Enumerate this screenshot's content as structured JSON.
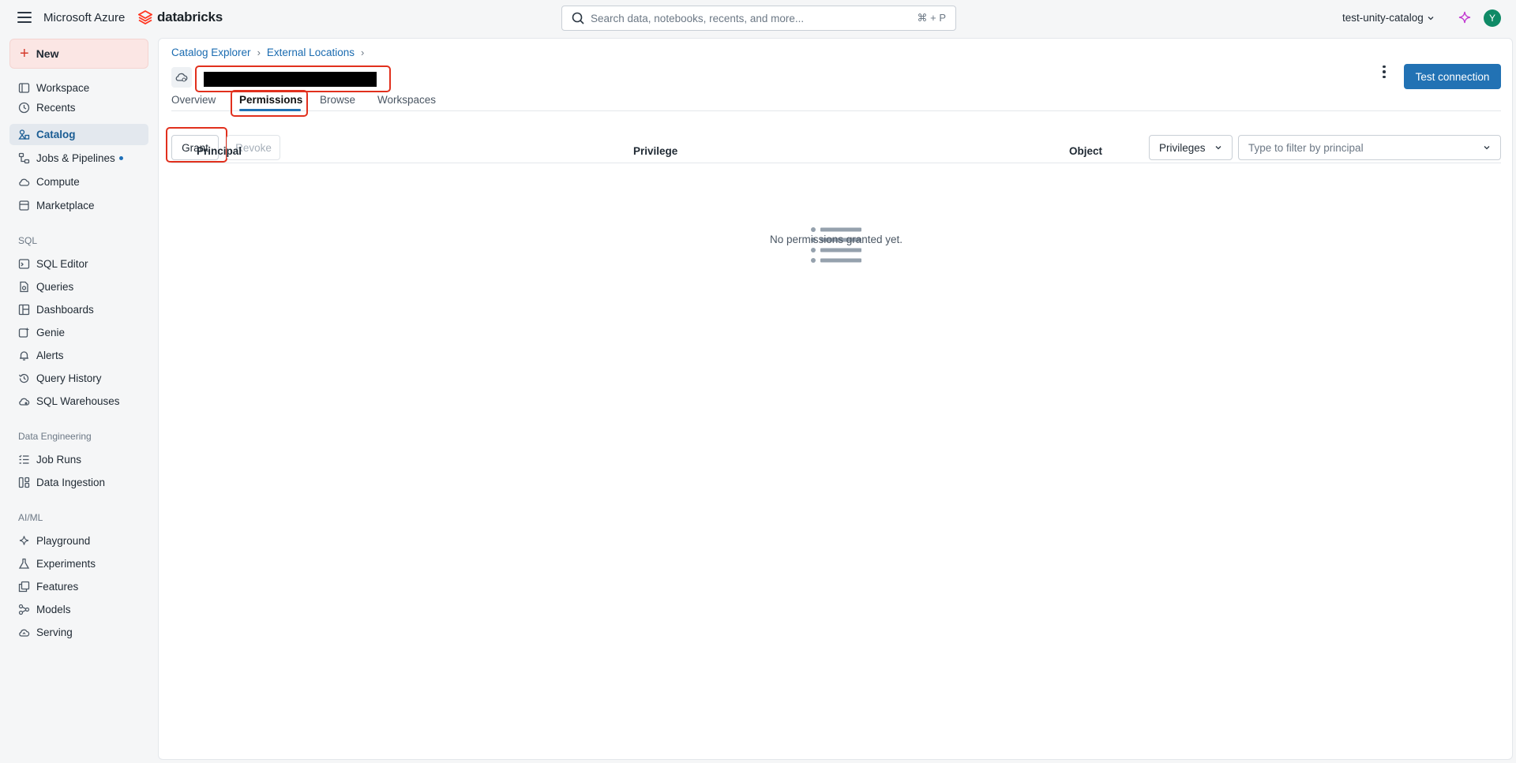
{
  "header": {
    "cloud_label": "Microsoft Azure",
    "brand": "databricks",
    "search_placeholder": "Search data, notebooks, recents, and more...",
    "search_shortcut": "⌘ + P",
    "workspace": "test-unity-catalog",
    "avatar_initial": "Y"
  },
  "sidebar": {
    "new_label": "New",
    "top_items": [
      {
        "label": "Workspace"
      },
      {
        "label": "Recents"
      },
      {
        "label": "Catalog",
        "active": true
      },
      {
        "label": "Jobs & Pipelines"
      },
      {
        "label": "Compute"
      },
      {
        "label": "Marketplace"
      }
    ],
    "sql_label": "SQL",
    "sql_items": [
      {
        "label": "SQL Editor"
      },
      {
        "label": "Queries"
      },
      {
        "label": "Dashboards"
      },
      {
        "label": "Genie"
      },
      {
        "label": "Alerts"
      },
      {
        "label": "Query History"
      },
      {
        "label": "SQL Warehouses"
      }
    ],
    "de_label": "Data Engineering",
    "de_items": [
      {
        "label": "Job Runs"
      },
      {
        "label": "Data Ingestion"
      }
    ],
    "ml_label": "AI/ML",
    "ml_items": [
      {
        "label": "Playground"
      },
      {
        "label": "Experiments"
      },
      {
        "label": "Features"
      },
      {
        "label": "Models"
      },
      {
        "label": "Serving"
      }
    ]
  },
  "main": {
    "breadcrumb": [
      "Catalog Explorer",
      "External Locations"
    ],
    "test_connection_label": "Test connection",
    "tabs": [
      {
        "label": "Overview"
      },
      {
        "label": "Permissions",
        "active": true
      },
      {
        "label": "Browse"
      },
      {
        "label": "Workspaces"
      }
    ],
    "grant_label": "Grant",
    "revoke_label": "Revoke",
    "privileges_dropdown": "Privileges",
    "filter_placeholder": "Type to filter by principal",
    "columns": [
      "Principal",
      "Privilege",
      "Object"
    ],
    "empty_message": "No permissions granted yet."
  },
  "colors": {
    "accent": "#2272b4",
    "highlight": "#e1301d",
    "brand": "#ff3621"
  }
}
